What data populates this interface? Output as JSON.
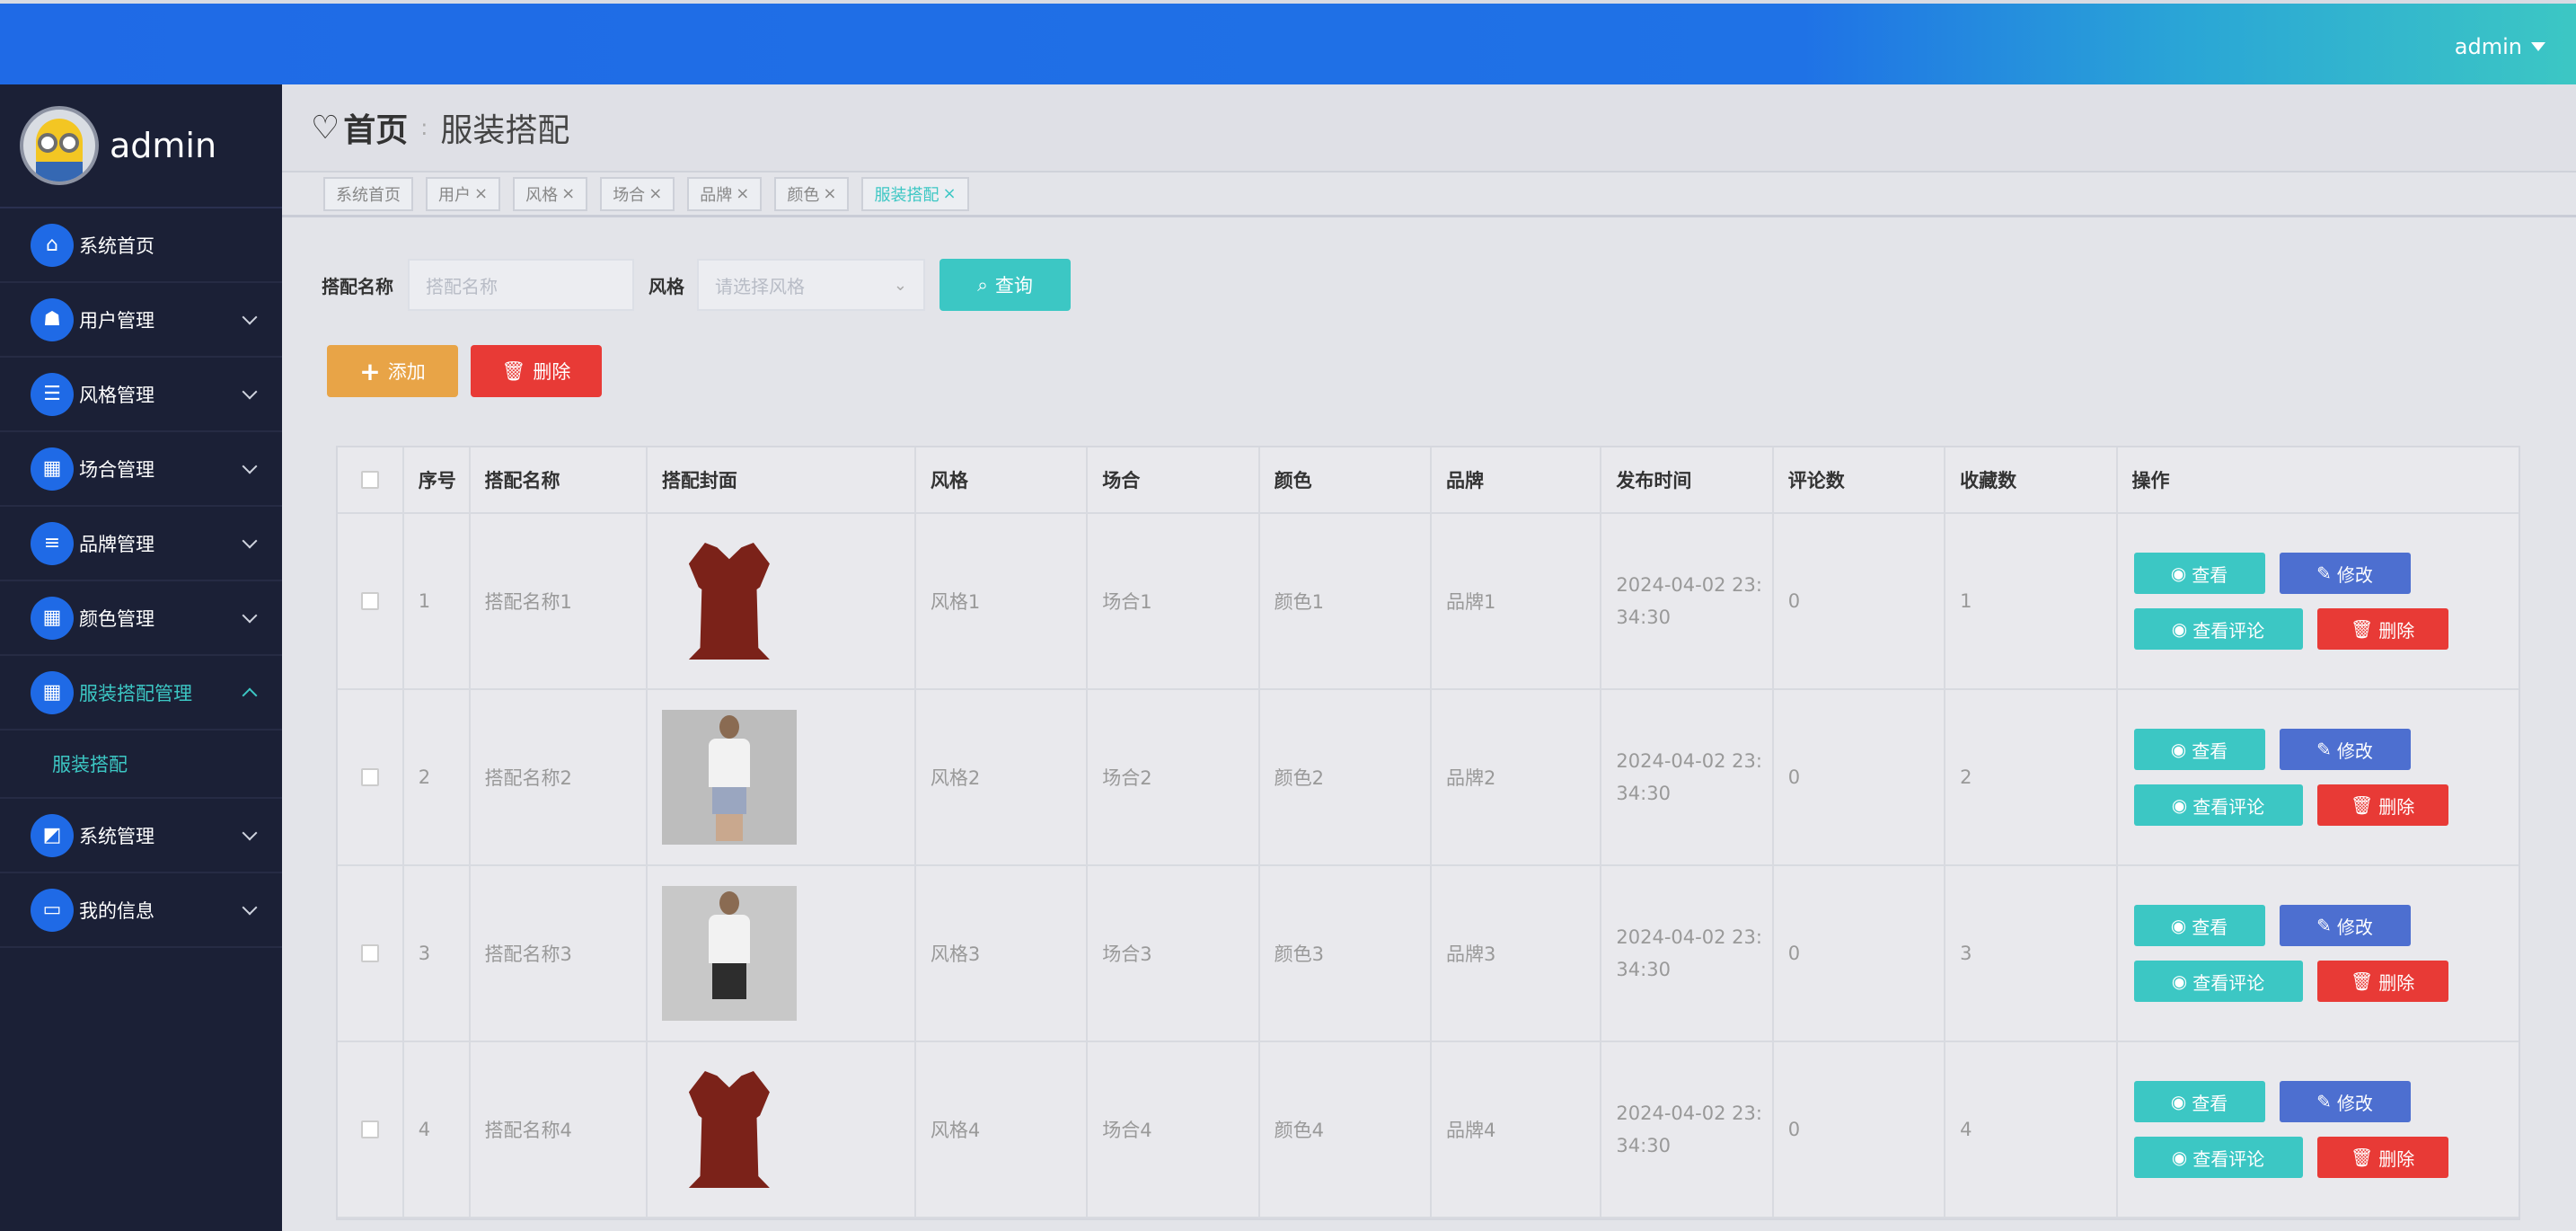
{
  "header": {
    "user": "admin"
  },
  "sidebar": {
    "name": "admin",
    "items": [
      {
        "label": "系统首页",
        "icon": "⌂"
      },
      {
        "label": "用户管理",
        "icon": "☗"
      },
      {
        "label": "风格管理",
        "icon": "☰"
      },
      {
        "label": "场合管理",
        "icon": "▦"
      },
      {
        "label": "品牌管理",
        "icon": "≡"
      },
      {
        "label": "颜色管理",
        "icon": "▦"
      },
      {
        "label": "服装搭配管理",
        "icon": "▦"
      },
      {
        "label": "系统管理",
        "icon": "◩"
      },
      {
        "label": "我的信息",
        "icon": "▭"
      }
    ],
    "sub_item": "服装搭配"
  },
  "breadcrumb": {
    "home": "首页",
    "current": "服装搭配"
  },
  "tags": [
    "系统首页",
    "用户",
    "风格",
    "场合",
    "品牌",
    "颜色",
    "服装搭配"
  ],
  "search": {
    "name_label": "搭配名称",
    "name_placeholder": "搭配名称",
    "style_label": "风格",
    "style_placeholder": "请选择风格",
    "query_button": "查询"
  },
  "actions": {
    "add": "添加",
    "delete": "删除"
  },
  "table": {
    "headers": [
      "序号",
      "搭配名称",
      "搭配封面",
      "风格",
      "场合",
      "颜色",
      "品牌",
      "发布时间",
      "评论数",
      "收藏数",
      "操作"
    ],
    "rows": [
      {
        "no": "1",
        "name": "搭配名称1",
        "style": "风格1",
        "occasion": "场合1",
        "color": "颜色1",
        "brand": "品牌1",
        "time1": "2024-04-02 23:",
        "time2": "34:30",
        "comments": "0",
        "favorites": "1"
      },
      {
        "no": "2",
        "name": "搭配名称2",
        "style": "风格2",
        "occasion": "场合2",
        "color": "颜色2",
        "brand": "品牌2",
        "time1": "2024-04-02 23:",
        "time2": "34:30",
        "comments": "0",
        "favorites": "2"
      },
      {
        "no": "3",
        "name": "搭配名称3",
        "style": "风格3",
        "occasion": "场合3",
        "color": "颜色3",
        "brand": "品牌3",
        "time1": "2024-04-02 23:",
        "time2": "34:30",
        "comments": "0",
        "favorites": "3"
      },
      {
        "no": "4",
        "name": "搭配名称4",
        "style": "风格4",
        "occasion": "场合4",
        "color": "颜色4",
        "brand": "品牌4",
        "time1": "2024-04-02 23:",
        "time2": "34:30",
        "comments": "0",
        "favorites": "4"
      }
    ],
    "ops": {
      "view": "查看",
      "edit": "修改",
      "comments": "查看评论",
      "delete": "删除"
    }
  },
  "colors": {
    "primary": "#1f6ae6",
    "teal": "#3cc7c4",
    "danger": "#e83a36",
    "warning": "#e8a447",
    "edit": "#4d6fd0",
    "sidebar": "#1b2036"
  }
}
